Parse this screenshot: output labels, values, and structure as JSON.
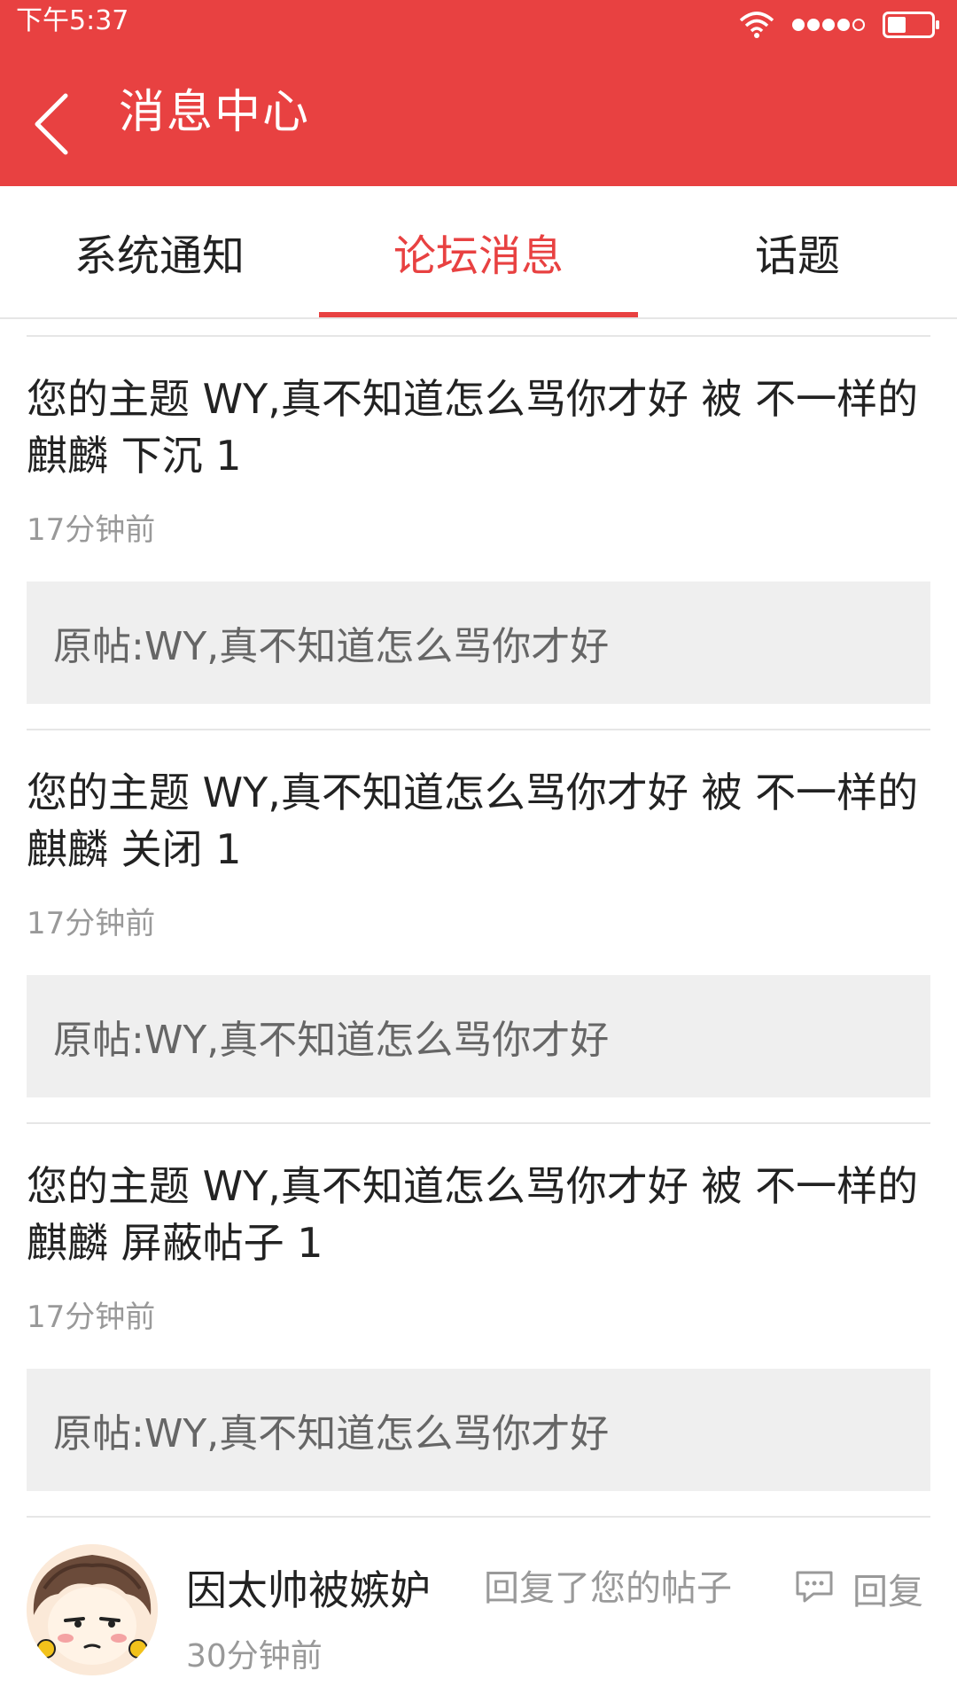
{
  "status_bar": {
    "time": "下午5:37",
    "icons": [
      "wifi-icon",
      "signal-icon",
      "battery-icon"
    ]
  },
  "header": {
    "title": "消息中心",
    "back_icon": "back-arrow-icon",
    "background_color": "#e84141"
  },
  "tabs": {
    "items": [
      {
        "label": "系统通知"
      },
      {
        "label": "论坛消息"
      },
      {
        "label": "话题"
      }
    ],
    "active_label": "论坛消息",
    "active_color": "#e84141"
  },
  "messages": [
    {
      "title": "您的主题 WY,真不知道怎么骂你才好 被 不一样的麒麟 下沉 1",
      "time": "17分钟前",
      "quote": "原帖:WY,真不知道怎么骂你才好"
    },
    {
      "title": "您的主题 WY,真不知道怎么骂你才好 被 不一样的麒麟 关闭 1",
      "time": "17分钟前",
      "quote": "原帖:WY,真不知道怎么骂你才好"
    },
    {
      "title": "您的主题 WY,真不知道怎么骂你才好 被 不一样的麒麟 屏蔽帖子 1",
      "time": "17分钟前",
      "quote": "原帖:WY,真不知道怎么骂你才好"
    }
  ],
  "reply": {
    "user_name": "因太帅被嫉妒",
    "action": "回复了您的帖子",
    "time": "30分钟前",
    "button_label": "回复",
    "button_icon": "comment-bubble-icon",
    "avatar_icon": "cartoon-boy-avatar"
  }
}
